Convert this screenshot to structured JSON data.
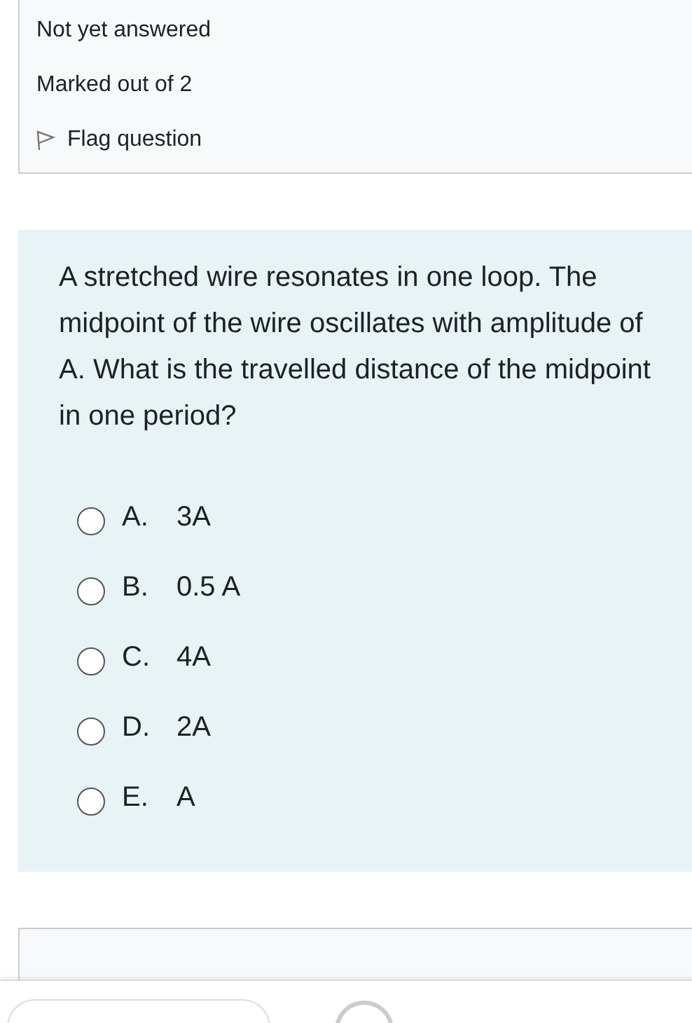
{
  "info": {
    "state": "Not yet answered",
    "marks": "Marked out of 2",
    "flag": {
      "label": "Flag question",
      "flagged": false
    }
  },
  "question": {
    "text": "A stretched wire resonates in one loop. The midpoint of the wire oscillates with amplitude of A. What is the travelled distance of the midpoint in one period?",
    "options": [
      {
        "letter": "A.",
        "answer": "3A",
        "selected": false
      },
      {
        "letter": "B.",
        "answer": "0.5 A",
        "selected": false
      },
      {
        "letter": "C.",
        "answer": "4A",
        "selected": false
      },
      {
        "letter": "D.",
        "answer": "2A",
        "selected": false
      },
      {
        "letter": "E.",
        "answer": "A",
        "selected": false
      }
    ]
  }
}
